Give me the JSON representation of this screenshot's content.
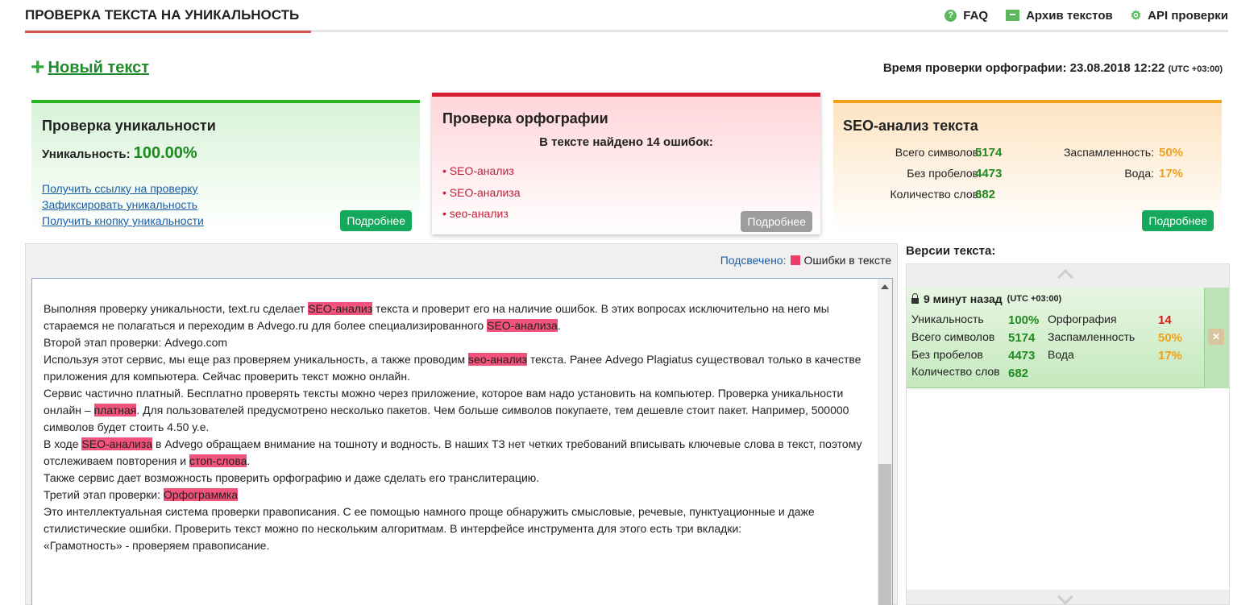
{
  "header": {
    "title": "ПРОВЕРКА ТЕКСТА НА УНИКАЛЬНОСТЬ",
    "links": [
      {
        "label": "FAQ",
        "icon": "question-icon"
      },
      {
        "label": "Архив текстов",
        "icon": "archive-icon"
      },
      {
        "label": "API проверки",
        "icon": "gear-icon"
      }
    ]
  },
  "new_text_label": "Новый текст",
  "check_time": {
    "label": "Время проверки орфографии: 23.08.2018 12:22",
    "tz": "(UTC +03:00)"
  },
  "uniqueness_card": {
    "title": "Проверка уникальности",
    "uniq_label": "Уникальность:",
    "uniq_value": "100.00%",
    "links": [
      "Получить ссылку на проверку",
      "Зафиксировать уникальность",
      "Получить кнопку уникальности"
    ],
    "more": "Подробнее"
  },
  "spelling_card": {
    "title": "Проверка орфографии",
    "found": "В тексте найдено 14 ошибок:",
    "errors": [
      "SEO-анализ",
      "SEO-анализа",
      "seo-анализ"
    ],
    "more": "Подробнее"
  },
  "seo_card": {
    "title": "SEO-анализ текста",
    "total_chars_label": "Всего символов:",
    "total_chars": "5174",
    "no_spaces_label": "Без пробелов:",
    "no_spaces": "4473",
    "words_label": "Количество слов:",
    "words": "682",
    "spam_label": "Заспамленность:",
    "spam": "50%",
    "water_label": "Вода:",
    "water": "17%",
    "more": "Подробнее"
  },
  "editor": {
    "legend_label": "Подсвечено:",
    "legend_item": "Ошибки в тексте",
    "colors": {
      "highlight": "#f2537a"
    },
    "paragraphs": [
      [
        {
          "t": "Выполняя проверку уникальности, text.ru сделает "
        },
        {
          "t": "SEO-анализ",
          "hl": true
        },
        {
          "t": " текста и проверит его на наличие ошибок. В этих вопросах исключительно на него мы стараемся не полагаться и переходим в Advego.ru для более специализированного "
        },
        {
          "t": "SEO-анализа",
          "hl": true
        },
        {
          "t": "."
        }
      ],
      [
        {
          "t": "Второй этап проверки: Advego.com"
        }
      ],
      [
        {
          "t": "Используя этот сервис, мы еще раз проверяем уникальность, а также проводим "
        },
        {
          "t": "seo-анализ",
          "hl": true
        },
        {
          "t": " текста. Ранее Advego Plagiatus существовал только в качестве приложения для компьютера. Сейчас проверить текст можно онлайн."
        }
      ],
      [
        {
          "t": "Сервис частично платный. Бесплатно проверять тексты можно через приложение, которое вам надо установить на компьютер. Проверка уникальности онлайн – "
        },
        {
          "t": "платная",
          "hl": true
        },
        {
          "t": ". Для пользователей предусмотрено несколько пакетов. Чем больше символов покупаете, тем дешевле стоит пакет. Например, 500000 символов будет стоить 4.50 у.е."
        }
      ],
      [
        {
          "t": " "
        }
      ],
      [
        {
          "t": "В ходе "
        },
        {
          "t": "SEO-анализа",
          "hl": true
        },
        {
          "t": " в Advego обращаем внимание на тошноту и водность. В наших ТЗ нет четких требований вписывать ключевые слова в текст, поэтому отслеживаем повторения и "
        },
        {
          "t": "стоп-слова",
          "hl": true
        },
        {
          "t": "."
        }
      ],
      [
        {
          "t": " "
        }
      ],
      [
        {
          "t": "Также сервис дает возможность проверить орфографию и даже сделать его транслитерацию."
        }
      ],
      [
        {
          "t": "Третий этап проверки: "
        },
        {
          "t": "Орфограммка",
          "hl": true
        }
      ],
      [
        {
          "t": "Это интеллектуальная система проверки правописания. С ее помощью намного проще обнаружить смысловые, речевые, пунктуационные и даже стилистические ошибки. Проверить текст можно по нескольким алгоритмам. В интерфейсе инструмента для этого есть три вкладки:"
        }
      ],
      [
        {
          "t": "«Грамотность» - проверяем правописание."
        }
      ]
    ]
  },
  "versions": {
    "title": "Версии текста:",
    "item": {
      "time": "9 минут назад",
      "tz": "(UTC +03:00)",
      "uniq_label": "Уникальность",
      "uniq": "100%",
      "total_label": "Всего символов",
      "total": "5174",
      "nospace_label": "Без пробелов",
      "nospace": "4473",
      "words_label": "Количество слов",
      "words": "682",
      "spell_label": "Орфография",
      "spell": "14",
      "spam_label": "Заспамленность",
      "spam": "50%",
      "water_label": "Вода",
      "water": "17%"
    }
  }
}
